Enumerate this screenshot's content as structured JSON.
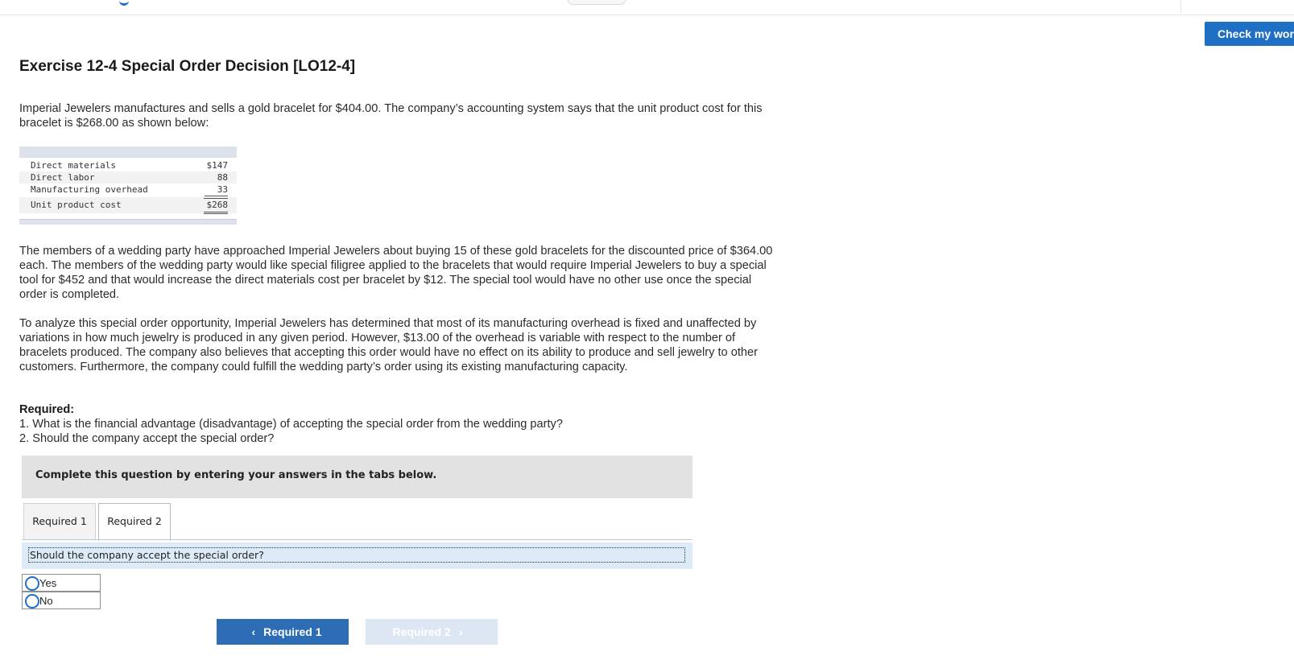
{
  "header": {
    "check_button": "Check my work"
  },
  "exercise": {
    "title": "Exercise 12-4 Special Order Decision [LO12-4]",
    "intro": "Imperial Jewelers manufactures and sells a gold bracelet for $404.00. The company’s accounting system says that the unit product cost for this bracelet is $268.00 as shown below:",
    "cost_table": {
      "rows": [
        {
          "label": "Direct materials",
          "value": "$147"
        },
        {
          "label": "Direct labor",
          "value": "88"
        },
        {
          "label": "Manufacturing overhead",
          "value": "33"
        }
      ],
      "total": {
        "label": "Unit product cost",
        "value": "$268"
      }
    },
    "paragraph2": "The members of a wedding party have approached Imperial Jewelers about buying 15 of these gold bracelets for the discounted price of $364.00 each. The members of the wedding party would like special filigree applied to the bracelets that would require Imperial Jewelers to buy a special tool for $452 and that would increase the direct materials cost per bracelet by $12. The special tool would have no other use once the special order is completed.",
    "paragraph3": "To analyze this special order opportunity, Imperial Jewelers has determined that most of its manufacturing overhead is fixed and unaffected by variations in how much jewelry is produced in any given period. However, $13.00 of the overhead is variable with respect to the number of bracelets produced. The company also believes that accepting this order would have no effect on its ability to produce and sell jewelry to other customers. Furthermore, the company could fulfill the wedding party’s order using its existing manufacturing capacity.",
    "required_heading": "Required:",
    "required_items": [
      "1. What is the financial advantage (disadvantage) of accepting the special order from the wedding party?",
      "2. Should the company accept the special order?"
    ]
  },
  "answer_area": {
    "instruction": "Complete this question by entering your answers in the tabs below.",
    "tabs": [
      {
        "label": "Required 1",
        "active": false
      },
      {
        "label": "Required 2",
        "active": true
      }
    ],
    "question": "Should the company accept the special order?",
    "options": [
      "Yes",
      "No"
    ],
    "nav": {
      "prev_label": "Required 1",
      "next_label": "Required 2",
      "prev_icon": "chevron-left-icon",
      "next_icon": "chevron-right-icon"
    }
  },
  "colors": {
    "accent": "#1f6fc5",
    "question_bg": "#dcebf7",
    "instruction_bg": "#e2e2e2",
    "disabled_button": "#dde7f4"
  }
}
